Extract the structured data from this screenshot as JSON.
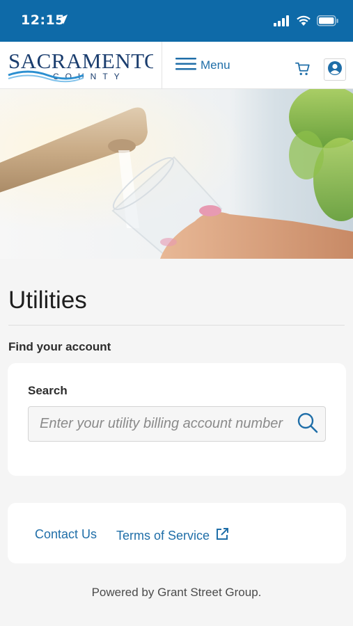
{
  "status_bar": {
    "time": "12:15"
  },
  "header": {
    "logo_line1": "SACRAMENTO",
    "logo_line2": "COUNTY",
    "menu_label": "Menu"
  },
  "main": {
    "title": "Utilities",
    "section_label": "Find your account",
    "search": {
      "label": "Search",
      "placeholder": "Enter your utility billing account number",
      "value": ""
    }
  },
  "links": {
    "contact": "Contact Us",
    "terms": "Terms of Service"
  },
  "footer": {
    "powered_by": "Powered by Grant Street Group."
  },
  "colors": {
    "status_bar_bg": "#0e6aa8",
    "link": "#1f6ea8",
    "page_bg": "#f5f5f5"
  },
  "icons": {
    "menu": "hamburger-icon",
    "cart": "cart-icon",
    "user": "user-circle-icon",
    "search": "search-icon",
    "external": "external-link-icon"
  }
}
